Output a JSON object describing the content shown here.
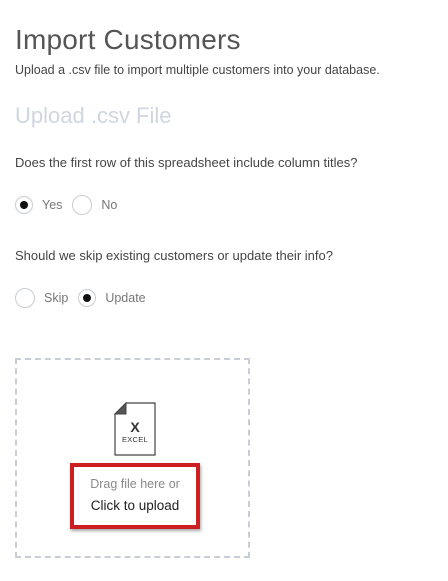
{
  "page": {
    "title": "Import Customers",
    "subtitle": "Upload a .csv file to import multiple customers into your database."
  },
  "upload_section": {
    "heading": "Upload .csv File"
  },
  "question_header_row": {
    "text": "Does the first row of this spreadsheet include column titles?",
    "options": [
      {
        "label": "Yes",
        "selected": true
      },
      {
        "label": "No",
        "selected": false
      }
    ]
  },
  "question_existing": {
    "text": "Should we skip existing customers or update their info?",
    "options": [
      {
        "label": "Skip",
        "selected": false
      },
      {
        "label": "Update",
        "selected": true
      }
    ]
  },
  "dropzone": {
    "file_icon": {
      "name": "excel-file-icon",
      "glyph": "X",
      "caption": "EXCEL"
    },
    "drag_text": "Drag file here or",
    "click_text": "Click to upload"
  },
  "colors": {
    "highlight_border": "#cc1f1f",
    "heading_muted": "#cfd6e0",
    "dropzone_border": "#c9cdd6"
  }
}
